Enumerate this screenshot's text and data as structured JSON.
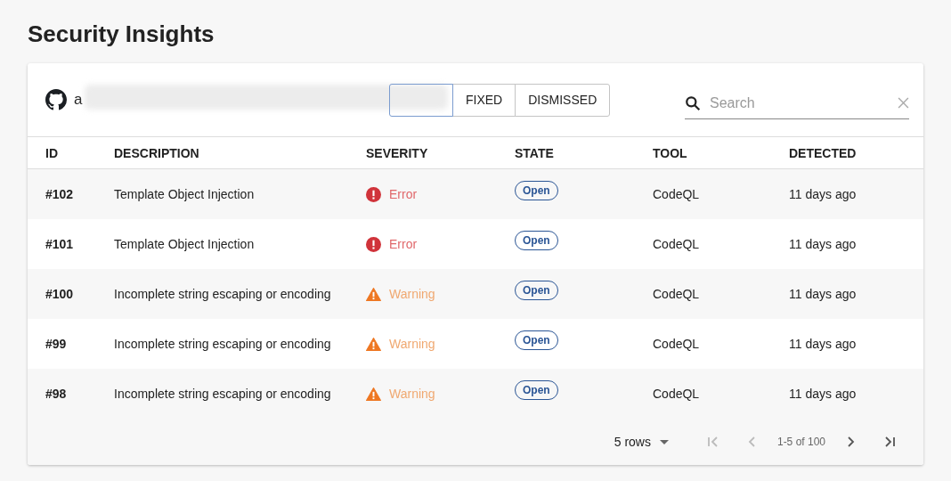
{
  "page_title": "Security Insights",
  "repo": {
    "visible_start": "a"
  },
  "state_filter": [
    {
      "selected": true
    },
    {
      "label": "FIXED",
      "selected": false
    },
    {
      "label": "DISMISSED",
      "selected": false
    }
  ],
  "search": {
    "placeholder": "Search"
  },
  "table": {
    "columns": [
      "ID",
      "DESCRIPTION",
      "SEVERITY",
      "STATE",
      "TOOL",
      "DETECTED"
    ],
    "rows": [
      {
        "id": "#102",
        "description": "Template Object Injection",
        "severity": {
          "kind": "error",
          "label": "Error"
        },
        "state": "Open",
        "tool": "CodeQL",
        "detected": "11 days ago"
      },
      {
        "id": "#101",
        "description": "Template Object Injection",
        "severity": {
          "kind": "error",
          "label": "Error"
        },
        "state": "Open",
        "tool": "CodeQL",
        "detected": "11 days ago"
      },
      {
        "id": "#100",
        "description": "Incomplete string escaping or encoding",
        "severity": {
          "kind": "warning",
          "label": "Warning"
        },
        "state": "Open",
        "tool": "CodeQL",
        "detected": "11 days ago"
      },
      {
        "id": "#99",
        "description": "Incomplete string escaping or encoding",
        "severity": {
          "kind": "warning",
          "label": "Warning"
        },
        "state": "Open",
        "tool": "CodeQL",
        "detected": "11 days ago"
      },
      {
        "id": "#98",
        "description": "Incomplete string escaping or encoding",
        "severity": {
          "kind": "warning",
          "label": "Warning"
        },
        "state": "Open",
        "tool": "CodeQL",
        "detected": "11 days ago"
      }
    ]
  },
  "pagination": {
    "rows_per_page": "5 rows",
    "range": "1-5 of 100",
    "first_disabled": true,
    "prev_disabled": true,
    "next_disabled": false,
    "last_disabled": false
  }
}
